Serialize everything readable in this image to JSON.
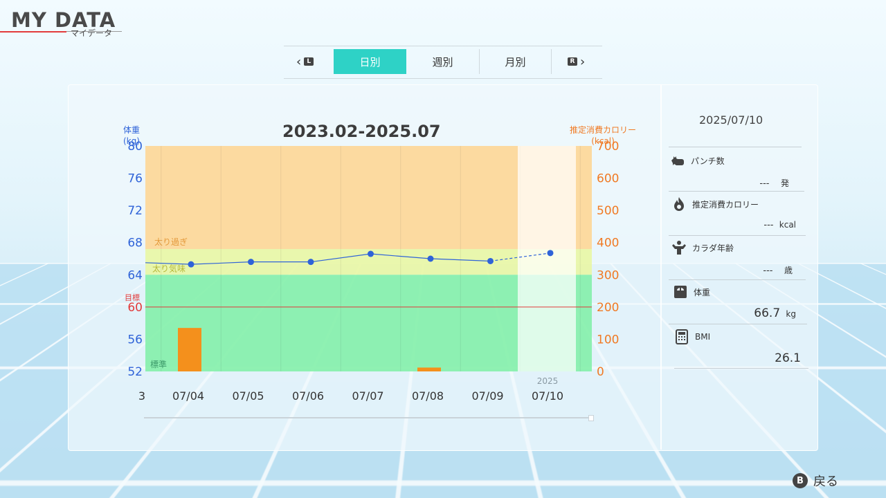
{
  "header": {
    "title": "MY DATA",
    "subtitle": "マイデータ"
  },
  "tabs": {
    "left_button": "L",
    "right_button": "R",
    "items": [
      {
        "label": "日別",
        "active": true
      },
      {
        "label": "週別",
        "active": false
      },
      {
        "label": "月別",
        "active": false
      }
    ]
  },
  "chart": {
    "title": "2023.02-2025.07",
    "y1_title_line1": "体重",
    "y1_title_line2": "(kg)",
    "y2_title_line1": "推定消費カロリー",
    "y2_title_line2": "(kcal)",
    "target_label": "目標",
    "zone_labels": [
      "太り過ぎ",
      "太り気味",
      "標準"
    ],
    "year_label": "2025",
    "left_cut_label": "3"
  },
  "chart_data": {
    "type": "line+bar",
    "title": "2023.02-2025.07",
    "categories": [
      "07/04",
      "07/05",
      "07/06",
      "07/07",
      "07/08",
      "07/09",
      "07/10"
    ],
    "series": [
      {
        "name": "体重",
        "axis": "left",
        "unit": "kg",
        "values": [
          65.3,
          65.6,
          65.6,
          66.6,
          66.0,
          65.7,
          66.7
        ],
        "color": "#2f63d8"
      },
      {
        "name": "推定消費カロリー",
        "axis": "right",
        "unit": "kcal",
        "values": [
          135,
          null,
          null,
          null,
          12,
          null,
          null
        ],
        "color": "#f4901c"
      }
    ],
    "left_edge_weight": 65.5,
    "target_weight": 60,
    "y1_ticks": [
      80,
      76,
      72,
      68,
      64,
      60,
      56,
      52
    ],
    "y2_ticks": [
      700,
      600,
      500,
      400,
      300,
      200,
      100,
      0
    ],
    "y1_range": [
      52,
      80
    ],
    "y2_range": [
      0,
      700
    ],
    "zones": [
      {
        "label": "太り過ぎ",
        "from": 67.2,
        "to": 80,
        "color": "#ffd590"
      },
      {
        "label": "太り気味",
        "from": 64,
        "to": 67.2,
        "color": "#e9f7a0"
      },
      {
        "label": "標準",
        "from": 52,
        "to": 64,
        "color": "#7ef0a6"
      }
    ],
    "selected_category": "07/10",
    "colors": {
      "weight_line": "#2f63d8",
      "calorie_bar": "#f4901c",
      "target_line": "#e23a3a",
      "accent": "#2ed2c6"
    }
  },
  "sidebar": {
    "date": "2025/07/10",
    "items": [
      {
        "label": "パンチ数",
        "value": "---",
        "unit": "発",
        "icon": "boxing-glove-icon"
      },
      {
        "label": "推定消費カロリー",
        "value": "---",
        "unit": "kcal",
        "icon": "flame-icon"
      },
      {
        "label": "カラダ年齢",
        "value": "---",
        "unit": "歳",
        "icon": "flexing-body-icon"
      },
      {
        "label": "体重",
        "value": "66.7",
        "unit": "kg",
        "icon": "scale-icon"
      },
      {
        "label": "BMI",
        "value": "26.1",
        "unit": "",
        "icon": "calculator-icon"
      }
    ]
  },
  "footer": {
    "back_button": "B",
    "back_label": "戻る"
  }
}
